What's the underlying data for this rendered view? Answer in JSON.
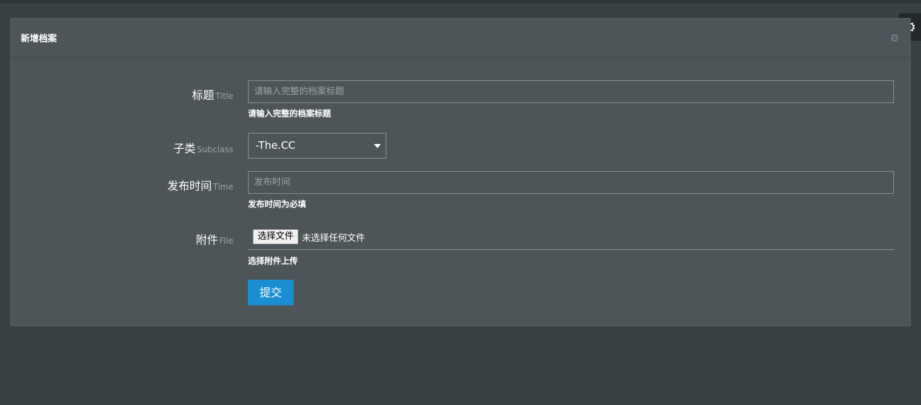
{
  "panel": {
    "title": "新增档案",
    "cog_icon": "cog-icon"
  },
  "settings_tab": {
    "icon": "gear-icon"
  },
  "form": {
    "title": {
      "label": "标题",
      "sublabel": "Title",
      "placeholder": "请输入完整的档案标题",
      "value": "",
      "help": "请输入完整的档案标题"
    },
    "subclass": {
      "label": "子类",
      "sublabel": "Subclass",
      "selected": "-The.CC"
    },
    "time": {
      "label": "发布时间",
      "sublabel": "Time",
      "placeholder": "发布时间",
      "value": "",
      "help": "发布时间为必填"
    },
    "file": {
      "label": "附件",
      "sublabel": "File",
      "button_label": "选择文件",
      "status": "未选择任何文件",
      "help": "选择附件上传"
    },
    "submit_label": "提交"
  },
  "colors": {
    "background": "#3a4144",
    "panel": "#4e5558",
    "primary_button": "#1a8ed1"
  }
}
